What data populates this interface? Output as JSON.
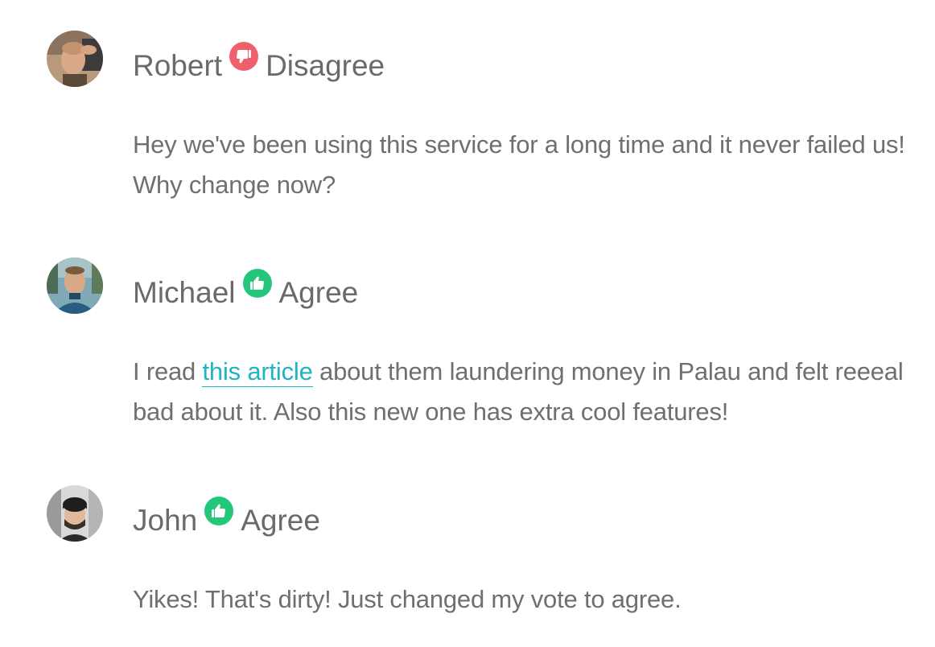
{
  "comments": [
    {
      "author": "Robert",
      "vote": "Disagree",
      "vote_icon": "thumbs-down-icon",
      "vote_color": "#f0606b",
      "text": "Hey we've been using this service for a long time and it never failed us! Why change now?"
    },
    {
      "author": "Michael",
      "vote": "Agree",
      "vote_icon": "thumbs-up-icon",
      "vote_color": "#22c77a",
      "text_before_link": "I read ",
      "link_text": "this article",
      "text_after_link": " about them laundering money in Palau and felt reeeal bad about it. Also this new one has extra cool features!"
    },
    {
      "author": "John",
      "vote": "Agree",
      "vote_icon": "thumbs-up-icon",
      "vote_color": "#22c77a",
      "text": "Yikes! That's dirty! Just changed my vote to agree."
    }
  ],
  "colors": {
    "link": "#1fb3c4",
    "text": "#6b6b6b"
  }
}
